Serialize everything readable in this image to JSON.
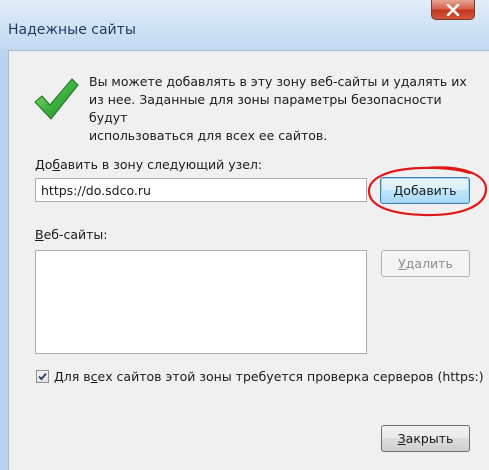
{
  "window": {
    "title": "Надежные сайты"
  },
  "info": {
    "text": "Вы можете добавлять в эту зону  веб-сайты и удалять их\nиз нее. Заданные для зоны параметры безопасности будут\nиспользоваться для всех ее сайтов.",
    "icon": "green-checkmark-icon"
  },
  "add_zone": {
    "label_pre": "До",
    "label_accel": "б",
    "label_post": "авить в зону следующий узел:",
    "input_value": "https://do.sdco.ru",
    "add_button": "Добавить"
  },
  "sites": {
    "label_accel": "В",
    "label_post": "еб-сайты:",
    "items": [],
    "remove_accel": "У",
    "remove_post": "далить"
  },
  "verify": {
    "checked": true,
    "label_pre": "Для в",
    "label_accel": "с",
    "label_post": "ех сайтов этой зоны требуется проверка серверов (https:)"
  },
  "footer": {
    "close_accel": "З",
    "close_post": "акрыть"
  },
  "colors": {
    "accent_button_border": "#3c7fb1",
    "annotation_red": "#e01818",
    "check_green": "#2fa52f",
    "close_button_red": "#c2391f"
  }
}
